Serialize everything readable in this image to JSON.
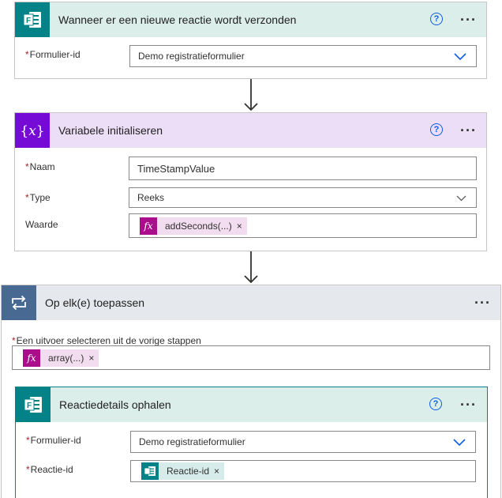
{
  "trigger": {
    "title": "Wanneer er een nieuwe reactie wordt verzonden",
    "help": "?",
    "form_label": "Formulier-id",
    "form_value": "Demo registratieformulier",
    "icon": "forms-icon",
    "header_color": "#dbeeea",
    "icon_color": "#038387"
  },
  "init_var": {
    "title": "Variabele initialiseren",
    "help": "?",
    "name_label": "Naam",
    "name_value": "TimeStampValue",
    "type_label": "Type",
    "type_value": "Reeks",
    "value_label": "Waarde",
    "value_token": "addSeconds(...)",
    "value_token_icon": "fx-icon",
    "header_color": "#ecdef6",
    "icon_color": "#770bd6"
  },
  "foreach": {
    "title": "Op elk(e) toepassen",
    "select_label": "Een uitvoer selecteren uit de vorige stappen",
    "token": "array(...)",
    "token_icon": "fx-icon",
    "header_color": "#e5e9ee",
    "icon_color": "#486991"
  },
  "get_details": {
    "title": "Reactiedetails ophalen",
    "help": "?",
    "form_label": "Formulier-id",
    "form_value": "Demo registratieformulier",
    "response_label": "Reactie-id",
    "response_token": "Reactie-id",
    "response_token_icon": "forms-icon",
    "header_color": "#dbeeea",
    "icon_color": "#038387"
  },
  "required_mark": "*",
  "more_dots": "···",
  "close_x": "×",
  "colors": {
    "fx_token_bg": "#f2dcef",
    "fx_icon": "#ab0e8a",
    "forms_token_bg": "#d5ecea",
    "link_blue": "#0f5ee0",
    "required_red": "#a4262c"
  }
}
